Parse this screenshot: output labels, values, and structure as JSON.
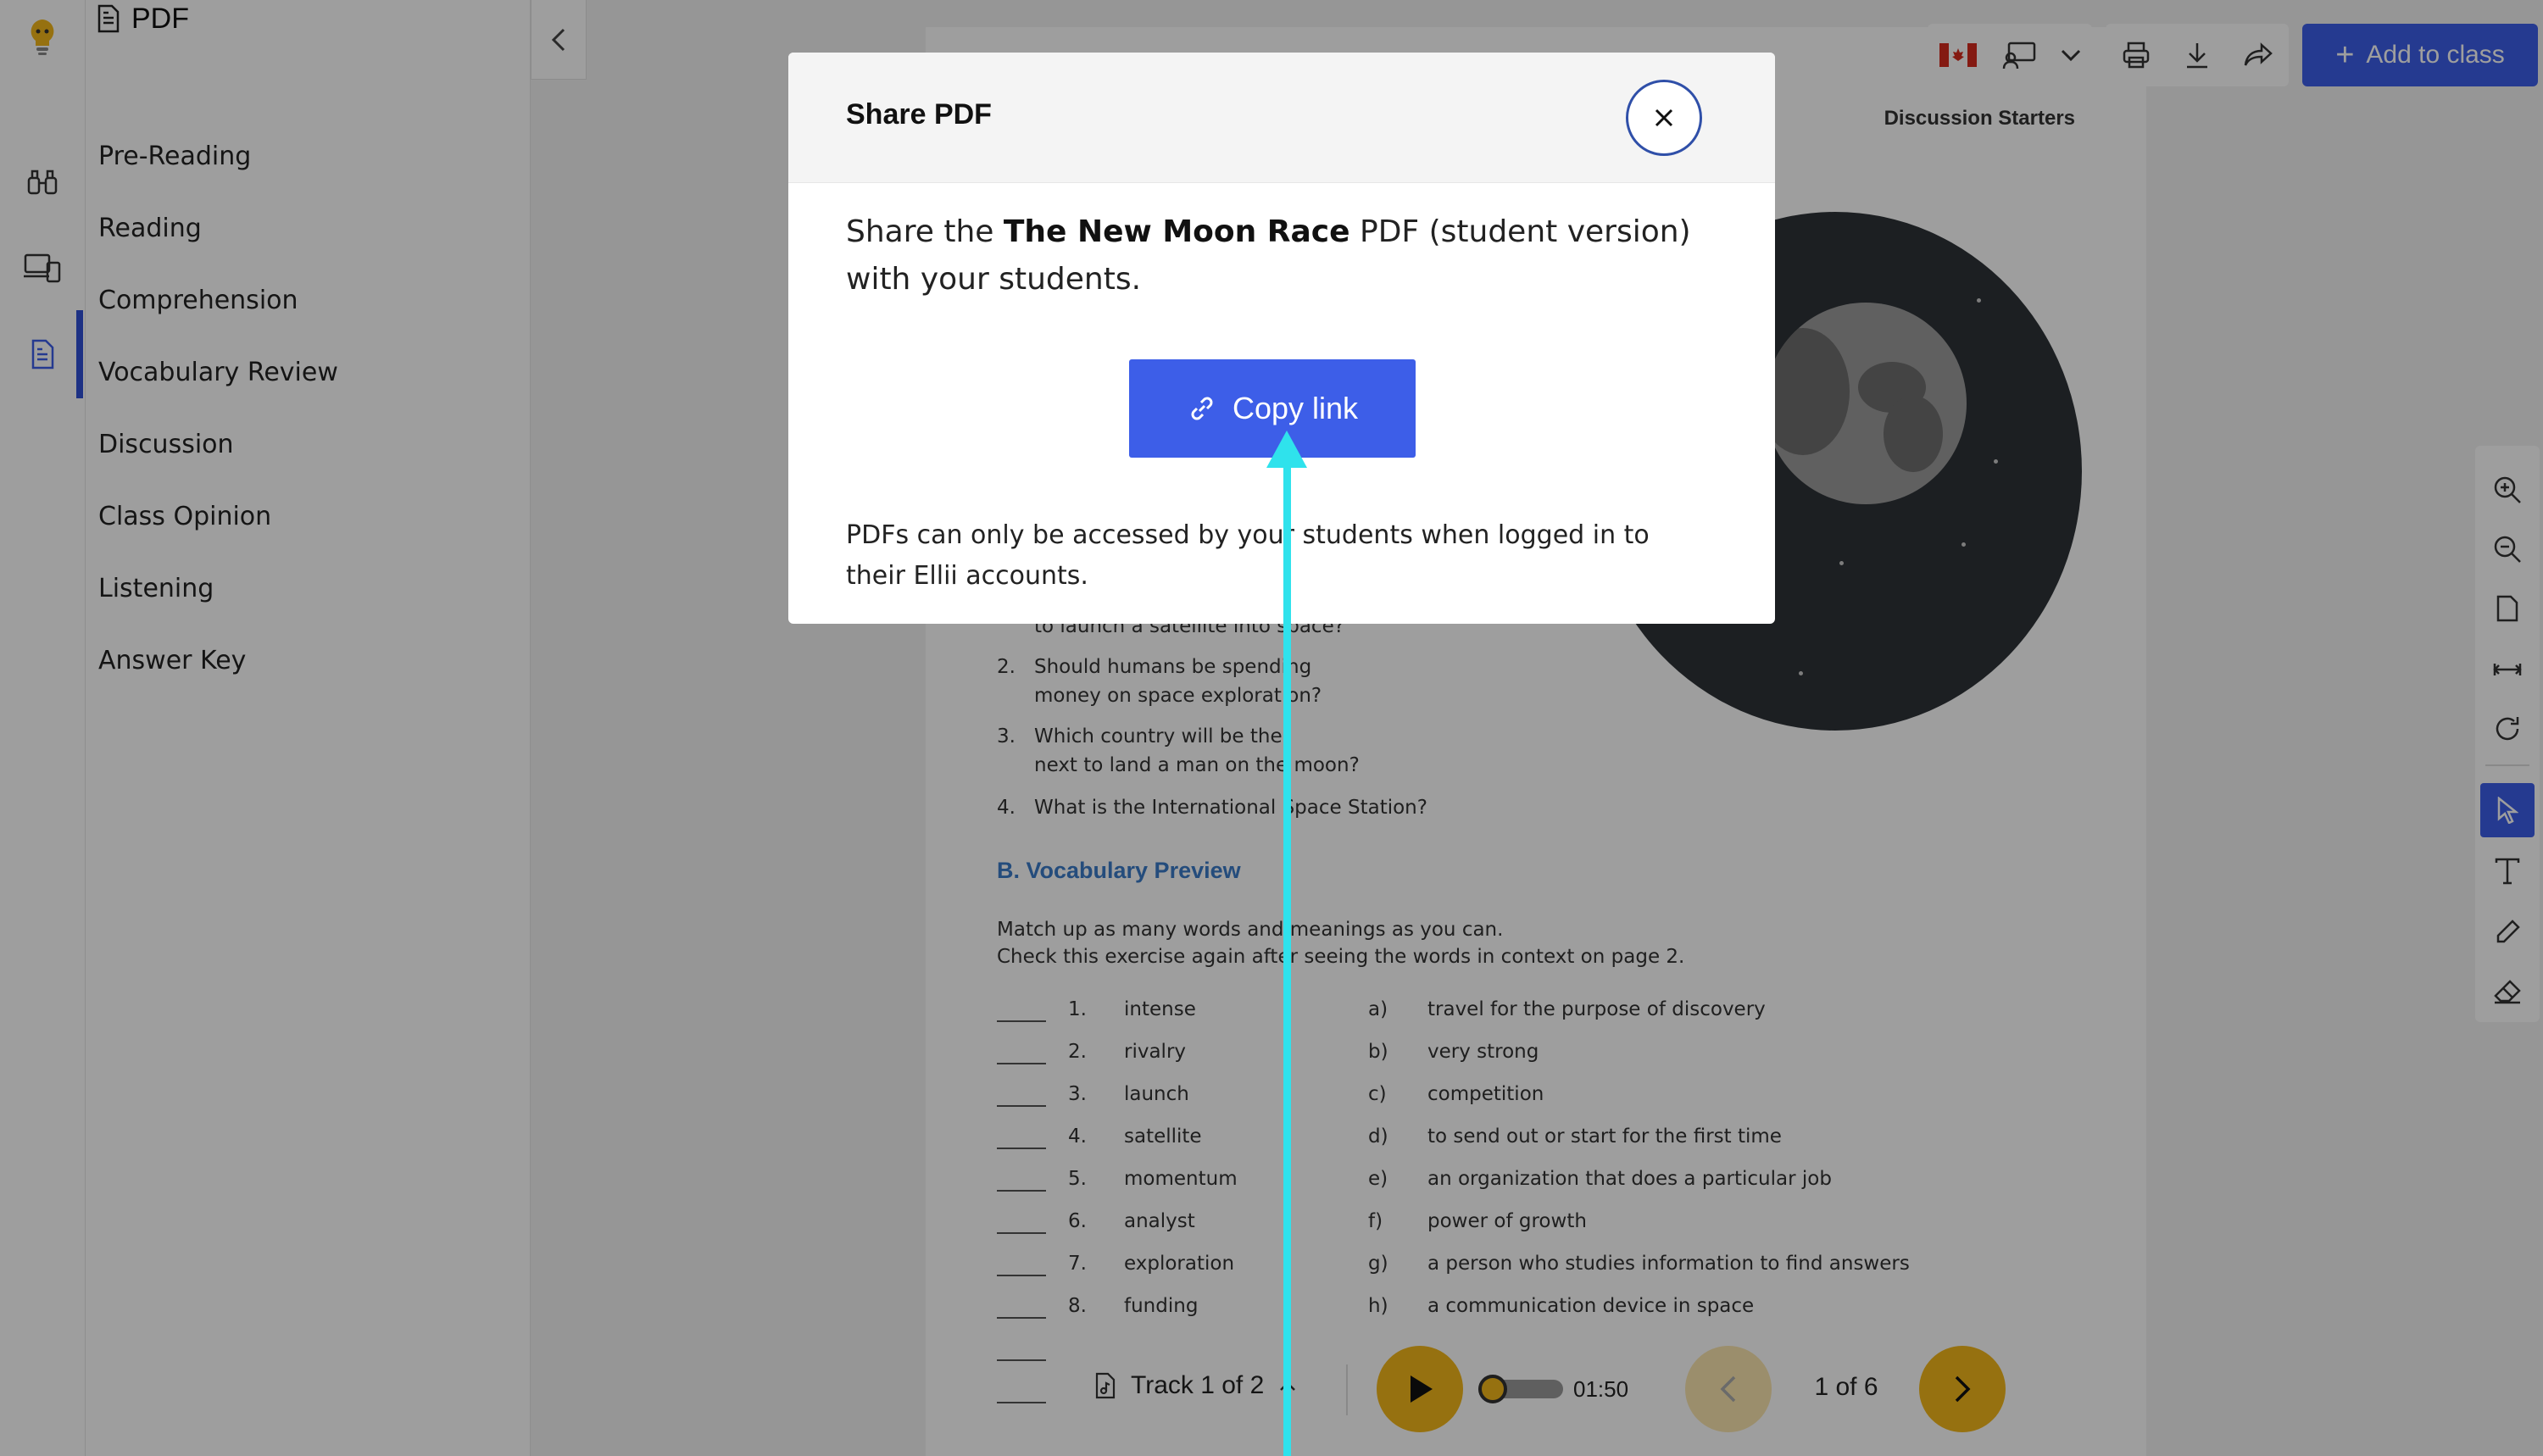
{
  "header": {
    "title": "PDF"
  },
  "sidebar": {
    "items": [
      {
        "label": "Pre-Reading"
      },
      {
        "label": "Reading"
      },
      {
        "label": "Comprehension"
      },
      {
        "label": "Vocabulary Review"
      },
      {
        "label": "Discussion"
      },
      {
        "label": "Class Opinion"
      },
      {
        "label": "Listening"
      },
      {
        "label": "Answer Key"
      }
    ],
    "active_index": 3
  },
  "toolbar": {
    "add_to_class_label": "Add to class",
    "icons": [
      "canada-flag-icon",
      "classroom-display-icon",
      "chevron-down-icon",
      "print-icon",
      "download-icon",
      "share-icon"
    ]
  },
  "document": {
    "header_label": "Discussion Starters",
    "questions": [
      {
        "num": "",
        "text": "to launch a satellite into space?"
      },
      {
        "num": "2.",
        "text": "Should humans be spending"
      },
      {
        "num": "",
        "text": "money on space exploration?"
      },
      {
        "num": "3.",
        "text": "Which country will be the"
      },
      {
        "num": "",
        "text": "next to land a man on the moon?"
      },
      {
        "num": "4.",
        "text": "What is the International Space Station?"
      }
    ],
    "section_title": "B. Vocabulary Preview",
    "instructions": [
      "Match up as many words and meanings as you can.",
      "Check this exercise again after seeing the words in context on page 2."
    ],
    "vocab": [
      {
        "num": "1.",
        "word": "intense",
        "letter": "a)",
        "definition": "travel for the purpose of discovery"
      },
      {
        "num": "2.",
        "word": "rivalry",
        "letter": "b)",
        "definition": "very strong"
      },
      {
        "num": "3.",
        "word": "launch",
        "letter": "c)",
        "definition": "competition"
      },
      {
        "num": "4.",
        "word": "satellite",
        "letter": "d)",
        "definition": "to send out or start for the first time"
      },
      {
        "num": "5.",
        "word": "momentum",
        "letter": "e)",
        "definition": "an organization that does a particular job"
      },
      {
        "num": "6.",
        "word": "analyst",
        "letter": "f)",
        "definition": "power of growth"
      },
      {
        "num": "7.",
        "word": "exploration",
        "letter": "g)",
        "definition": "a person who studies information to find answers"
      },
      {
        "num": "8.",
        "word": "funding",
        "letter": "h)",
        "definition": "a communication device in space"
      }
    ]
  },
  "audio": {
    "track_label": "Track 1 of 2",
    "time": "01:50",
    "progress": 0.0
  },
  "pager": {
    "label": "1 of 6"
  },
  "modal": {
    "title": "Share PDF",
    "message_prefix": "Share the ",
    "message_bold": "The New Moon Race",
    "message_suffix": " PDF (student version) with your students.",
    "copy_label": "Copy link",
    "note": "PDFs can only be accessed by your students when logged in to their Ellii accounts."
  },
  "colors": {
    "accent": "#3d5ee8",
    "audio_yellow": "#f3b71a",
    "section_blue": "#3a7bc8",
    "annotation": "#2fe2ec"
  }
}
